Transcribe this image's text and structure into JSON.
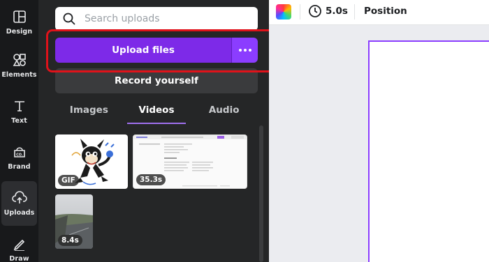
{
  "rail": {
    "items": [
      {
        "label": "Design",
        "icon": "layout-icon"
      },
      {
        "label": "Elements",
        "icon": "shapes-icon"
      },
      {
        "label": "Text",
        "icon": "text-icon"
      },
      {
        "label": "Brand",
        "icon": "brand-icon"
      },
      {
        "label": "Uploads",
        "icon": "cloud-upload-icon"
      },
      {
        "label": "Draw",
        "icon": "pen-icon"
      }
    ],
    "active": "Uploads"
  },
  "search": {
    "placeholder": "Search uploads"
  },
  "upload": {
    "label": "Upload files",
    "more_icon": "more-dots-icon"
  },
  "record": {
    "label": "Record yourself"
  },
  "tabs": [
    {
      "label": "Images"
    },
    {
      "label": "Videos"
    },
    {
      "label": "Audio"
    }
  ],
  "active_tab": "Videos",
  "uploads": [
    {
      "badge": "GIF",
      "kind": "cartoon cat gif"
    },
    {
      "badge": "35.3s",
      "kind": "screen recording"
    },
    {
      "badge": "8.4s",
      "kind": "road video"
    }
  ],
  "toolbar": {
    "duration": "5.0s",
    "position": "Position"
  },
  "colors": {
    "accent": "#8b3dff",
    "upload_button": "#7d2ae8",
    "highlight": "#e0121a",
    "panel": "#252627",
    "rail": "#18191b"
  }
}
